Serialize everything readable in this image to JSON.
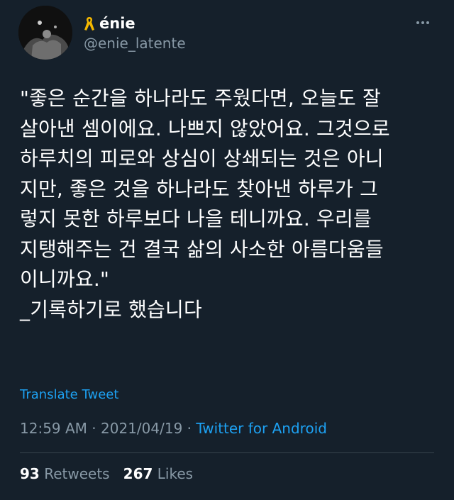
{
  "user": {
    "display_name": "énie",
    "handle": "@enie_latente",
    "badge_icon": "yellow-ribbon-icon",
    "badge_color": "#f5b800"
  },
  "tweet": {
    "text": "\"좋은 순간을 하나라도 주웠다면, 오늘도 잘\n살아낸 셈이에요. 나쁘지 않았어요. 그것으로\n하루치의 피로와 상심이 상쇄되는 것은 아니\n지만, 좋은 것을 하나라도 찾아낸 하루가 그\n렇지 못한 하루보다 나을 테니까요. 우리를\n지탱해주는 건 결국 삶의 사소한 아름다움들\n이니까요.\"\n_기록하기로 했습니다",
    "translate_label": "Translate Tweet",
    "time": "12:59 AM",
    "separator": " · ",
    "date": "2021/04/19",
    "source": "Twitter for Android"
  },
  "stats": {
    "retweets_count": "93",
    "retweets_label": "Retweets",
    "likes_count": "267",
    "likes_label": "Likes"
  },
  "colors": {
    "background": "#15202b",
    "accent": "#1da1f2",
    "secondary_text": "#8899a6"
  }
}
